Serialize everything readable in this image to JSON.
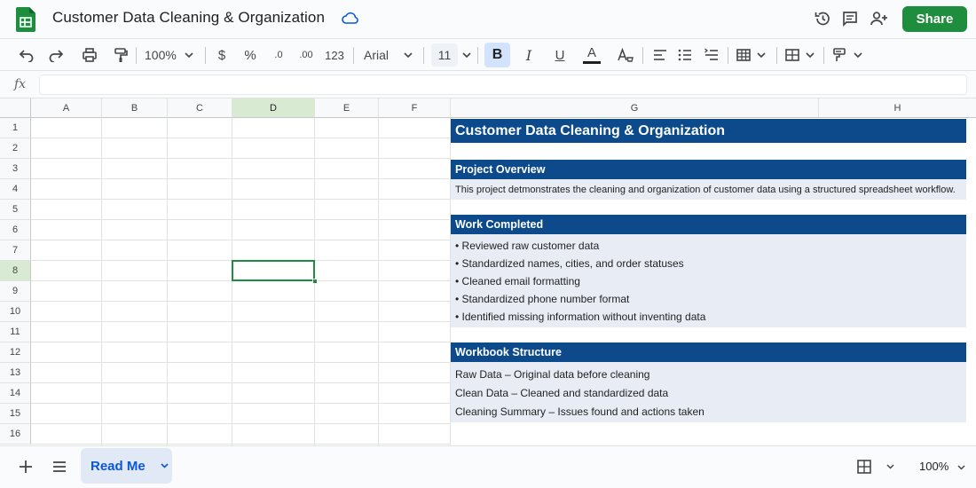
{
  "app": {
    "title": "Customer Data Cleaning & Organization",
    "share_label": "Share"
  },
  "toolbar": {
    "zoom": "100%",
    "currency": "$",
    "percent": "%",
    "decrease_decimal": ".0",
    "increase_decimal": ".00",
    "number_format": "123",
    "font": "Arial",
    "font_size": "11",
    "bold": "B",
    "italic": "I",
    "underline": "U",
    "text_color": "A"
  },
  "formula_bar": {
    "fx": "fx",
    "value": ""
  },
  "grid": {
    "columns": [
      "A",
      "B",
      "C",
      "D",
      "E",
      "F",
      "G",
      "H"
    ],
    "rows": [
      "1",
      "2",
      "3",
      "4",
      "5",
      "6",
      "7",
      "8",
      "9",
      "10",
      "11",
      "12",
      "13",
      "14",
      "15",
      "16"
    ],
    "active_cell": "D8"
  },
  "content": {
    "heading": "Customer Data Cleaning & Organization",
    "overview_title": "Project Overview",
    "overview_text": "This project detmonstrates the cleaning and organization of customer data using a structured spreadsheet workflow.",
    "work_title": "Work Completed",
    "work_items": [
      "Reviewed raw customer data",
      "Standardized names, cities, and order statuses",
      "Cleaned email formatting",
      "Standardized phone number format",
      "Identified missing information without inventing data"
    ],
    "structure_title": "Workbook Structure",
    "structure_items": [
      "Raw Data – Original data before cleaning",
      "Clean Data – Cleaned and standardized data",
      "Cleaning Summary – Issues found and actions taken"
    ]
  },
  "bottom": {
    "sheet_tab": "Read Me",
    "zoom": "100%"
  },
  "colors": {
    "header_band": "#0c4a8c",
    "light_band": "#e8edf5",
    "share_button": "#1e8e3e",
    "active_cell_border": "#1e8e3e"
  }
}
